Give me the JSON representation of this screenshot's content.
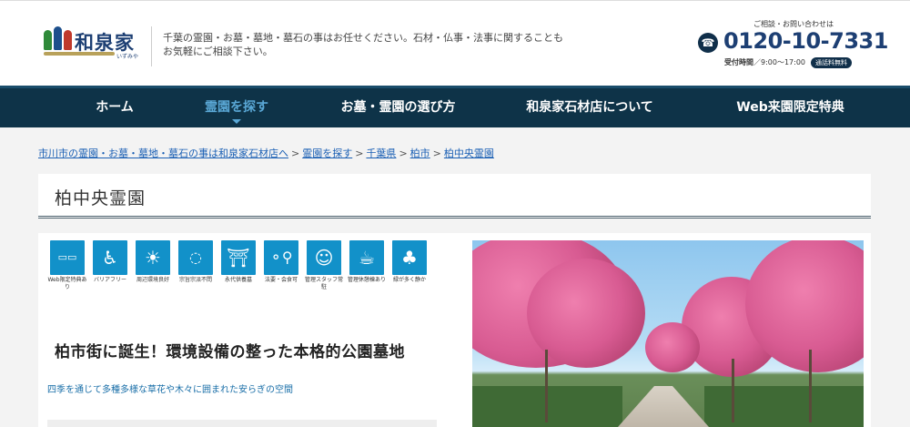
{
  "header": {
    "logo_text": "和泉家",
    "logo_sub": "いずみや",
    "tagline": "千葉の霊園・お墓・墓地・墓石の事はお任せください。石材・仏事・法事に関することもお気軽にご相談下さい。",
    "contact_label": "ご相談・お問い合わせは",
    "phone": "0120-10-7331",
    "hours_label": "受付時間",
    "hours": "／9:00～17:00",
    "free_badge": "通話料無料"
  },
  "nav": {
    "items": [
      {
        "label": "ホーム"
      },
      {
        "label": "霊園を探す",
        "active": true
      },
      {
        "label": "お墓・霊園の選び方"
      },
      {
        "label": "和泉家石材店について"
      },
      {
        "label": "Web来園限定特典"
      }
    ]
  },
  "breadcrumb": [
    "市川市の霊園・お墓・墓地・墓石の事は和泉家石材店へ",
    "霊園を探す",
    "千葉県",
    "柏市",
    "柏中央霊園"
  ],
  "page_title": "柏中央霊園",
  "features": [
    {
      "label": "Web限定特典あり",
      "icon": "coupon-icon"
    },
    {
      "label": "バリアフリー",
      "icon": "wheelchair-icon"
    },
    {
      "label": "周辺環境良好",
      "icon": "sun-person-icon"
    },
    {
      "label": "宗旨宗派不問",
      "icon": "beads-icon"
    },
    {
      "label": "永代供養墓",
      "icon": "stupa-icon"
    },
    {
      "label": "法要・会食可",
      "icon": "dining-icon"
    },
    {
      "label": "管理スタッフ常駐",
      "icon": "staff-icon"
    },
    {
      "label": "管理休憩棟あり",
      "icon": "rest-building-icon"
    },
    {
      "label": "緑が多く静か",
      "icon": "trees-icon"
    }
  ],
  "headline": "柏市街に誕生！環境設備の整った本格的公園墓地",
  "subline": "四季を通じて多種多様な草花や木々に囲まれた安らぎの空間"
}
